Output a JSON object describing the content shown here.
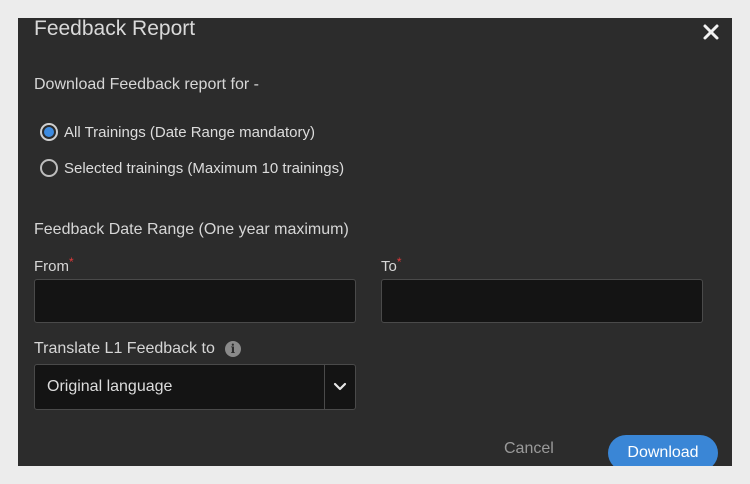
{
  "dialog": {
    "title": "Feedback Report",
    "close_icon": "close-icon"
  },
  "report_for": {
    "prompt": "Download Feedback report for -",
    "options": [
      {
        "label": "All Trainings (Date Range mandatory)",
        "checked": true
      },
      {
        "label": "Selected trainings (Maximum 10 trainings)",
        "checked": false
      }
    ]
  },
  "date_range": {
    "label": "Feedback Date Range (One year maximum)",
    "from_label": "From",
    "to_label": "To",
    "required_marker": "*",
    "from_value": "",
    "to_value": ""
  },
  "translate": {
    "label": "Translate L1 Feedback to",
    "info_icon": "info-icon",
    "selected": "Original language"
  },
  "footer": {
    "cancel_label": "Cancel",
    "download_label": "Download"
  },
  "colors": {
    "accent": "#3a86d6",
    "required": "#e03a3a",
    "dialog_bg": "#2c2c2c",
    "input_bg": "#141414"
  }
}
